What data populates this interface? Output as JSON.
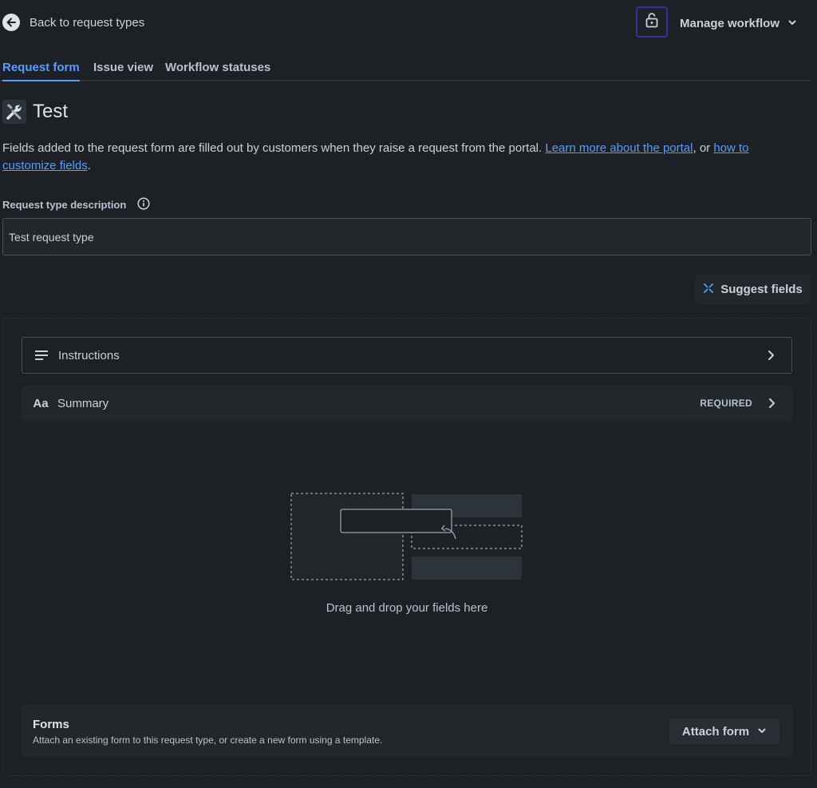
{
  "header": {
    "back_label": "Back to request types",
    "manage_label": "Manage workflow"
  },
  "tabs": [
    {
      "label": "Request form",
      "active": true
    },
    {
      "label": "Issue view",
      "active": false
    },
    {
      "label": "Workflow statuses",
      "active": false
    }
  ],
  "page": {
    "title": "Test",
    "title_icon": "tools-icon",
    "help_prefix": "Fields added to the request form are filled out by customers when they raise a request from the portal. ",
    "help_link1": "Learn more about the portal",
    "help_middle": ", or ",
    "help_link2": "how to customize fields",
    "help_suffix": "."
  },
  "description": {
    "label": "Request type description",
    "value": "Test request type"
  },
  "suggest_label": "Suggest fields",
  "fields": [
    {
      "label": "Instructions",
      "icon": "text-lines-icon",
      "required": ""
    },
    {
      "label": "Summary",
      "icon": "text-style-icon",
      "icon_text": "Aa",
      "required": "REQUIRED"
    }
  ],
  "dropzone_text": "Drag and drop your fields here",
  "forms": {
    "title": "Forms",
    "subtitle": "Attach an existing form to this request type, or create a new form using a template.",
    "attach_label": "Attach form"
  },
  "colors": {
    "background": "#1d2125",
    "link": "#579dff",
    "lock_border": "#3b2f9e"
  }
}
